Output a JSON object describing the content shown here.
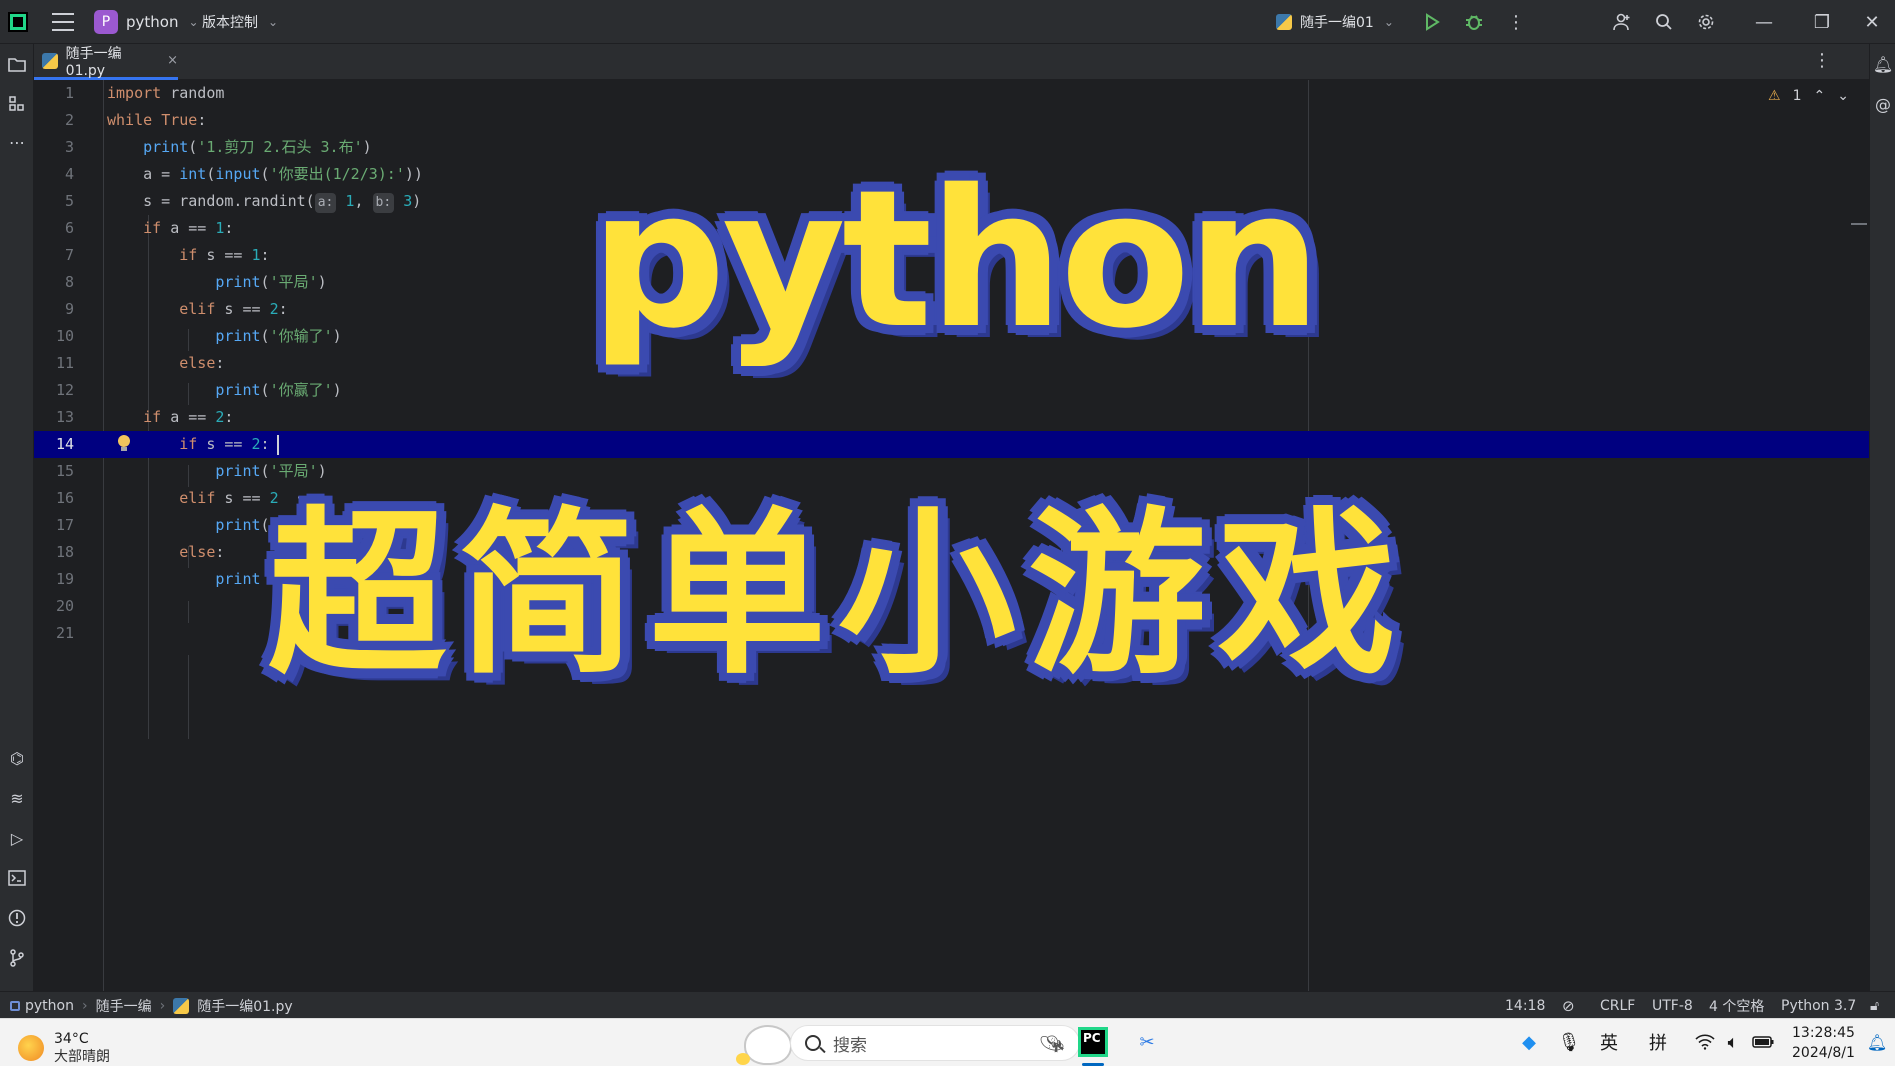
{
  "titlebar": {
    "project_badge": "P",
    "project_name": "python",
    "vcs_label": "版本控制",
    "run_config": "随手一编01"
  },
  "tab": {
    "filename": "随手一编01.py",
    "close": "×"
  },
  "inspections": {
    "warning_count": "1"
  },
  "code": {
    "line_numbers": [
      "1",
      "2",
      "3",
      "4",
      "5",
      "6",
      "7",
      "8",
      "9",
      "10",
      "11",
      "12",
      "13",
      "14",
      "15",
      "16",
      "17",
      "18",
      "19",
      "20",
      "21"
    ],
    "current_line": "14"
  },
  "overlay": {
    "line1": "python",
    "line2": "超简单小游戏"
  },
  "statusbar": {
    "breadcrumb": [
      "python",
      "随手一编",
      "随手一编01.py"
    ],
    "position": "14:18",
    "line_ending": "CRLF",
    "encoding": "UTF-8",
    "indent": "4 个空格",
    "interpreter": "Python 3.7"
  },
  "taskbar": {
    "weather_temp": "34°C",
    "weather_desc": "大部晴朗",
    "search_placeholder": "搜索",
    "pycharm_label": "PC",
    "ime_lang": "英",
    "ime_mode": "拼",
    "time": "13:28:45",
    "date": "2024/8/1"
  },
  "colors": {
    "accent": "#3574f0",
    "current_line": "#000080",
    "overlay_fill": "#ffe23a",
    "overlay_outline": "#3b4ab0"
  }
}
